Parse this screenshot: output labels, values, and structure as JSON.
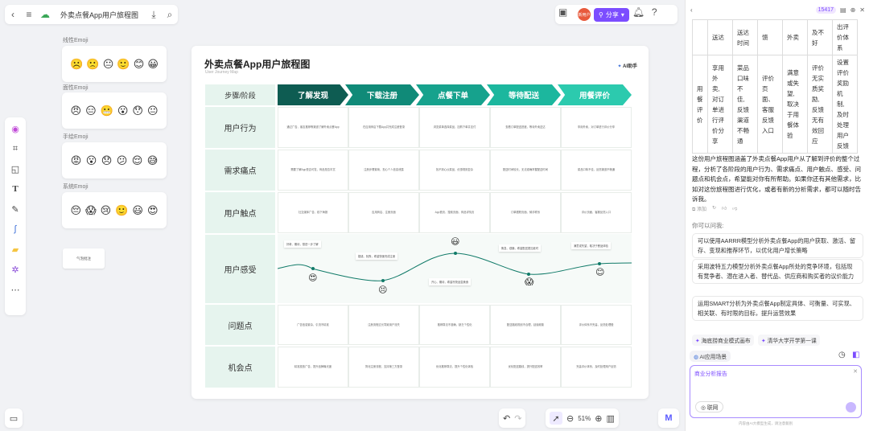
{
  "header": {
    "doc_title": "外卖点餐App用户旅程图"
  },
  "topbar_right": {
    "avatar_text": "新用户",
    "share_label": "分享"
  },
  "stickers": [
    {
      "title": "线性Emoji",
      "emojis": [
        "☹️",
        "🙁",
        "😐",
        "🙂",
        "😊",
        "😀"
      ]
    },
    {
      "title": "面性Emoji",
      "emojis": [
        "😠",
        "😑",
        "😬",
        "😮",
        "😯",
        "😐"
      ]
    },
    {
      "title": "手绘Emoji",
      "emojis": [
        "😡",
        "😮",
        "😞",
        "😕",
        "😌",
        "😅"
      ]
    },
    {
      "title": "系统Emoji",
      "emojis": [
        "😔",
        "😱",
        "😢",
        "🙂",
        "😃",
        "😍"
      ]
    }
  ],
  "note_text": "气泡批注",
  "board": {
    "title": "外卖点餐App用户旅程图",
    "subtitle": "User Journey Map",
    "ai_label": "AI助手",
    "step_header": "步骤/阶段",
    "stages": [
      "了解发现",
      "下载注册",
      "点餐下单",
      "等待配送",
      "用餐评价"
    ],
    "stage_colors": [
      "#0e5c52",
      "#108a78",
      "#16a28d",
      "#1cb79e",
      "#2ccaae"
    ],
    "rows": [
      {
        "label": "用户行为",
        "cells": [
          "通过广告、朋友推荐等渠道了解外卖点餐App",
          "在应用商店下载App并完成注册登录",
          "浏览菜单选择菜品，加购下单并支付",
          "查看订单配送进度，等待外卖送达",
          "享用外卖，对订单进行评价分享"
        ]
      },
      {
        "label": "需求痛点",
        "cells": [
          "需要了解App是否可靠，商品是否丰富",
          "注册步骤繁琐，担心个人信息泄露",
          "找不到心仪菜品，优惠规则复杂",
          "配送时间较长，无法准确掌握配送时间",
          "菜品口味不佳，反馈渠道不畅通"
        ]
      },
      {
        "label": "用户触点",
        "cells": [
          "社交媒体广告、线下海报",
          "应用商店、注册页面",
          "App首页、搜索页面、商品详情页",
          "订单跟踪页面、骑手联系",
          "评价页面、客服反馈入口"
        ]
      },
      {
        "label": "问题点",
        "cells": [
          "广告信息繁杂，引流不精准",
          "注册流程过长导致用户流失",
          "推荐算法不准确，缺乏个性化",
          "配送路线规划不合理，延误频繁",
          "评价体系不完善，反馈处理慢"
        ]
      },
      {
        "label": "机会点",
        "cells": [
          "精准投放广告，提升品牌曝光度",
          "简化注册流程，支持第三方登录",
          "优化推荐算法，提升个性化体验",
          "优化配送路线，提升配送效率",
          "完善评价体系，及时处理用户反馈"
        ]
      }
    ],
    "feel_label": "用户感受",
    "feelings": [
      "好奇、期待，想进一步了解",
      "疑惑、犹豫，希望快速完成注册",
      "开心、期待，希望尽快品尝美食",
      "焦急、烦躁，希望配送更加准时",
      "满意或失望，取决于餐品体验"
    ],
    "feel_emojis": [
      "😍",
      "😣",
      "😃",
      "😱",
      "😊"
    ]
  },
  "bottom_bar": {
    "zoom": "51%"
  },
  "panel": {
    "credits": "15417",
    "table": [
      {
        "col0": "",
        "cols": [
          "送达",
          "送达\n时间",
          "馈",
          "外卖",
          "及不\n好",
          "出评\n价体\n系"
        ]
      },
      {
        "col0": "用\n餐\n评\n价",
        "cols": [
          "享用\n外\n卖,\n对订\n单进\n行评\n价分\n享",
          "菜品\n口味\n不\n佳,\n反馈\n渠道\n不畅\n通",
          "评价\n页\n面、\n客服\n反馈\n入口",
          "满意\n或失\n望,\n取决\n于用\n餐体\n验",
          "评价\n无实\n质奖\n励,\n反馈\n无有\n效回\n应",
          "设置\n评价\n奖励\n机\n制,\n及时\n处理\n用户\n反馈"
        ]
      }
    ],
    "summary": "这份用户旅程图涵盖了外卖点餐App用户从了解到评价的整个过程，分析了各阶段的用户行为、需求痛点、用户触点、感受、问题点和机会点，希望能对你有所帮助。如果你还有其他需求，比如对这份旅程图进行优化，或者有新的分析需求，都可以随时告诉我。",
    "actions": [
      "添加"
    ],
    "ask_header": "你可以问我:",
    "suggestions": [
      "可以使用AARRR模型分析外卖点餐App的用户获取、激活、留存、变现和推荐环节，以优化用户增长策略",
      "采用波特五力模型分析外卖点餐App所处的竞争环境，包括现有竞争者、潜在进入者、替代品、供应商和购买者的议价能力",
      "运用SMART分析为外卖点餐App制定具体、可衡量、可实现、相关联、有时限的目标，提升运营效果"
    ],
    "chips": [
      "海底捞商业模式画布",
      "清华大学开学第一课"
    ],
    "ai_app": "AI应用场景",
    "input_tag": "商业分析报告",
    "net_label": "联网",
    "footer": "内容由AI大模型生成，请注意甄别"
  }
}
